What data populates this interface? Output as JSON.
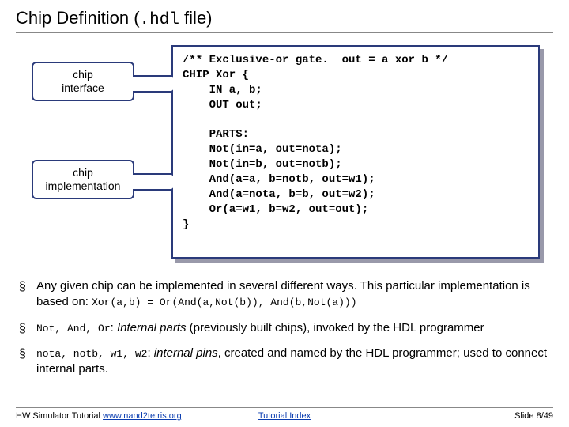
{
  "title_pre": "Chip Definition (",
  "title_mono": ".hdl",
  "title_post": " file)",
  "callouts": {
    "interface": "chip\ninterface",
    "implementation": "chip\nimplementation"
  },
  "code": "/** Exclusive-or gate.  out = a xor b */\nCHIP Xor {\n    IN a, b;\n    OUT out;\n\n    PARTS:\n    Not(in=a, out=nota);\n    Not(in=b, out=notb);\n    And(a=a, b=notb, out=w1);\n    And(a=nota, b=b, out=w2);\n    Or(a=w1, b=w2, out=out);\n}",
  "bullets": {
    "b1_a": "Any given chip can be implemented in several different ways. This particular implementation is based on: ",
    "b1_code": "Xor(a,b) = Or(And(a,Not(b)), And(b,Not(a)))",
    "b2_code": "Not, And, Or",
    "b2_a": ": ",
    "b2_i": "Internal parts",
    "b2_b": " (previously built chips), invoked by the HDL programmer",
    "b3_code": "nota, notb, w1, w2",
    "b3_a": ": ",
    "b3_i": "internal pins",
    "b3_b": ", created and named by the HDL programmer; used to connect internal parts."
  },
  "footer": {
    "left_text": "HW Simulator Tutorial ",
    "left_link": "www.nand2tetris.org",
    "mid": "Tutorial Index",
    "right": "Slide 8/49"
  }
}
